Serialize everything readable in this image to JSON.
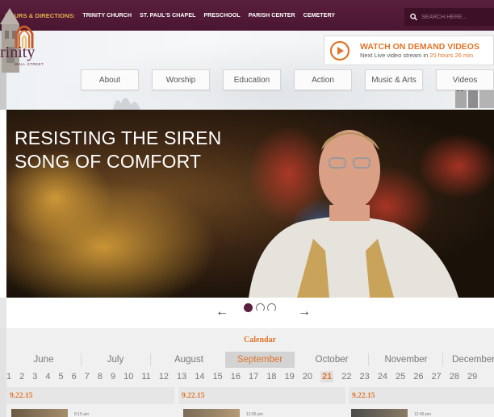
{
  "topbar": {
    "hours_label": "HOURS & DIRECTIONS:",
    "links": [
      "TRINITY CHURCH",
      "ST. PAUL'S CHAPEL",
      "PRESCHOOL",
      "PARISH CENTER",
      "CEMETERY"
    ],
    "search_placeholder": "SEARCH HERE..."
  },
  "header": {
    "logo_text": "rinity",
    "logo_subtext": "WALL STREET",
    "watch": {
      "title": "WATCH ON DEMAND VIDEOS",
      "subtitle_prefix": "Next Live video stream in",
      "countdown": "20 hours 26 min"
    },
    "nav": [
      "About",
      "Worship",
      "Education",
      "Action",
      "Music & Arts",
      "Videos"
    ]
  },
  "hero": {
    "heading_line1": "RESISTING THE SIREN",
    "heading_line2": "SONG OF COMFORT"
  },
  "carousel": {
    "prev": "←",
    "next": "→",
    "active_slide": 1,
    "slide_count": 3
  },
  "calendar": {
    "title": "Calendar",
    "months": [
      "June",
      "July",
      "August",
      "September",
      "October",
      "November",
      "December"
    ],
    "active_month": "September",
    "days": [
      "1",
      "2",
      "3",
      "4",
      "5",
      "6",
      "7",
      "8",
      "9",
      "10",
      "11",
      "12",
      "13",
      "14",
      "15",
      "16",
      "17",
      "18",
      "19",
      "20",
      "21",
      "22",
      "23",
      "24",
      "25",
      "26",
      "27",
      "28",
      "29"
    ],
    "today": "21",
    "columns": [
      {
        "date": "9.22.15",
        "time": "8:15 am"
      },
      {
        "date": "9.22.15",
        "time": "12:05 pm"
      },
      {
        "date": "9.22.15",
        "time": "12:45 pm"
      }
    ]
  },
  "colors": {
    "brand": "#5a1f3c",
    "accent": "#e0742a",
    "gold": "#e8b04a"
  }
}
